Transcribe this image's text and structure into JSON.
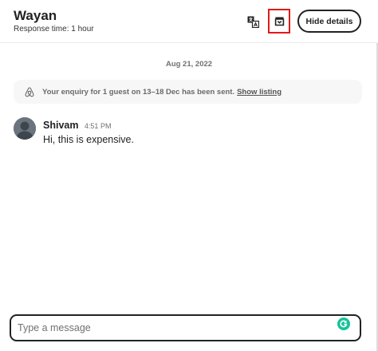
{
  "header": {
    "host_name": "Wayan",
    "response_time": "Response time: 1 hour",
    "translate_icon": "translate-icon",
    "archive_icon": "archive-icon",
    "hide_details_label": "Hide details",
    "highlight_color": "#e11a1a"
  },
  "thread": {
    "date_label": "Aug 21, 2022",
    "notice": {
      "icon": "airbnb-logo-icon",
      "text": "Your enquiry for 1 guest on 13–18 Dec has been sent.",
      "link_label": "Show listing"
    },
    "messages": [
      {
        "sender": "Shivam",
        "time": "4:51 PM",
        "text": "Hi, this is expensive."
      }
    ]
  },
  "composer": {
    "placeholder": "Type a message",
    "value": "",
    "assistant_icon": "grammarly-icon",
    "assistant_color": "#15c39a"
  }
}
